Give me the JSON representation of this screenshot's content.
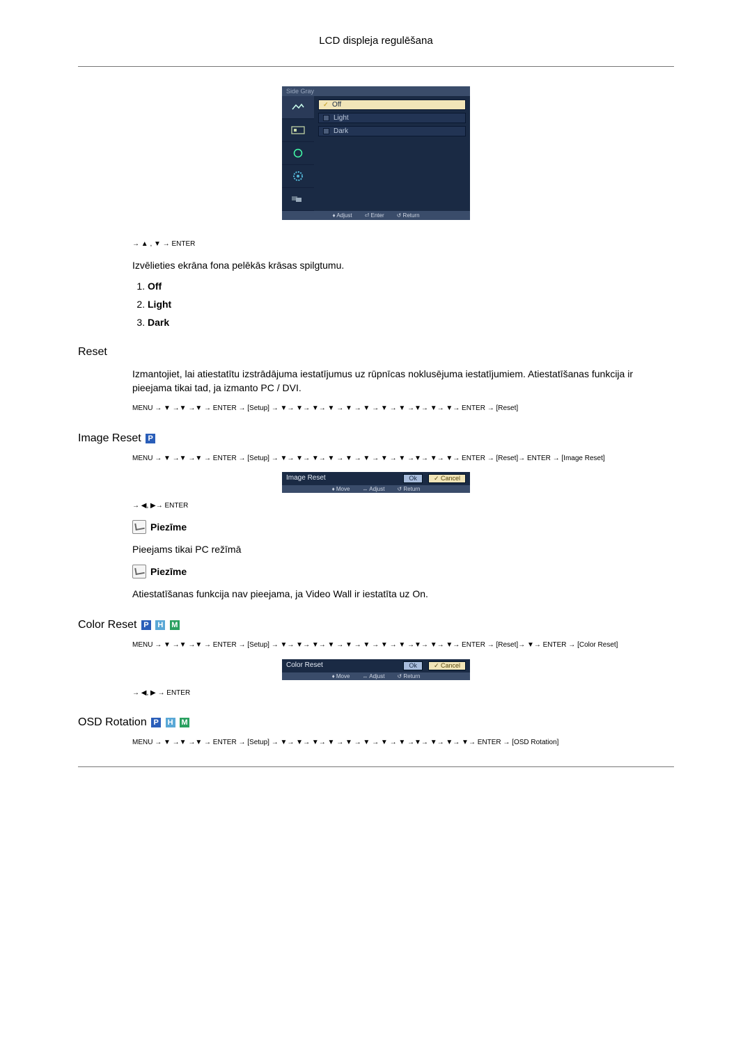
{
  "page_title": "LCD displeja regulēšana",
  "side_gray": {
    "title": "Side Gray",
    "options": [
      "Off",
      "Light",
      "Dark"
    ],
    "footer": {
      "adjust": "♦ Adjust",
      "enter": "⏎ Enter",
      "return": "↺ Return"
    },
    "nav": "→ ▲ , ▼ → ENTER",
    "intro": "Izvēlieties ekrāna fona pelēkās krāsas spilgtumu.",
    "list": [
      "Off",
      "Light",
      "Dark"
    ]
  },
  "reset": {
    "title": "Reset",
    "p1": "Izmantojiet, lai atiestatītu izstrādājuma iestatījumus uz rūpnīcas noklusējuma iestatījumiem. Atiestatīšanas funkcija ir pieejama tikai tad, ja izmanto PC / DVI.",
    "nav": "MENU → ▼ →▼ →▼ → ENTER → [Setup] → ▼→ ▼→ ▼→ ▼ → ▼ → ▼ → ▼ → ▼ →▼→ ▼→ ▼→ ENTER → [Reset]"
  },
  "image_reset": {
    "title": "Image Reset",
    "nav": "MENU → ▼ →▼ →▼ → ENTER → [Setup] → ▼→ ▼→ ▼→ ▼ → ▼ → ▼ → ▼ → ▼ →▼→ ▼→ ▼→ ENTER → [Reset]→ ENTER → [Image Reset]",
    "osd": {
      "label": "Image Reset",
      "ok": "Ok",
      "cancel": "✓ Cancel",
      "move": "♦ Move",
      "adjust": "↔ Adjust",
      "return": "↺ Return"
    },
    "nav2": "→ ◀, ▶→ ENTER",
    "note1_label": "Piezīme",
    "p2": "Pieejams tikai PC režīmā",
    "note2_label": "Piezīme",
    "p3": "Atiestatīšanas funkcija nav pieejama, ja Video Wall ir iestatīta uz On."
  },
  "color_reset": {
    "title": "Color Reset",
    "nav": "MENU → ▼ →▼ →▼ → ENTER → [Setup] → ▼→ ▼→ ▼→ ▼ → ▼ → ▼ → ▼ → ▼ →▼→ ▼→ ▼→ ENTER → [Reset]→ ▼→ ENTER → [Color Reset]",
    "osd": {
      "label": "Color Reset",
      "ok": "Ok",
      "cancel": "✓ Cancel",
      "move": "♦ Move",
      "adjust": "↔ Adjust",
      "return": "↺ Return"
    },
    "nav2": "→ ◀, ▶ → ENTER"
  },
  "osd_rotation": {
    "title": "OSD Rotation",
    "nav": "MENU → ▼ →▼ →▼ → ENTER → [Setup] → ▼→ ▼→ ▼→ ▼ → ▼ → ▼ → ▼ → ▼ →▼→ ▼→ ▼→ ▼→ ENTER → [OSD Rotation]"
  }
}
